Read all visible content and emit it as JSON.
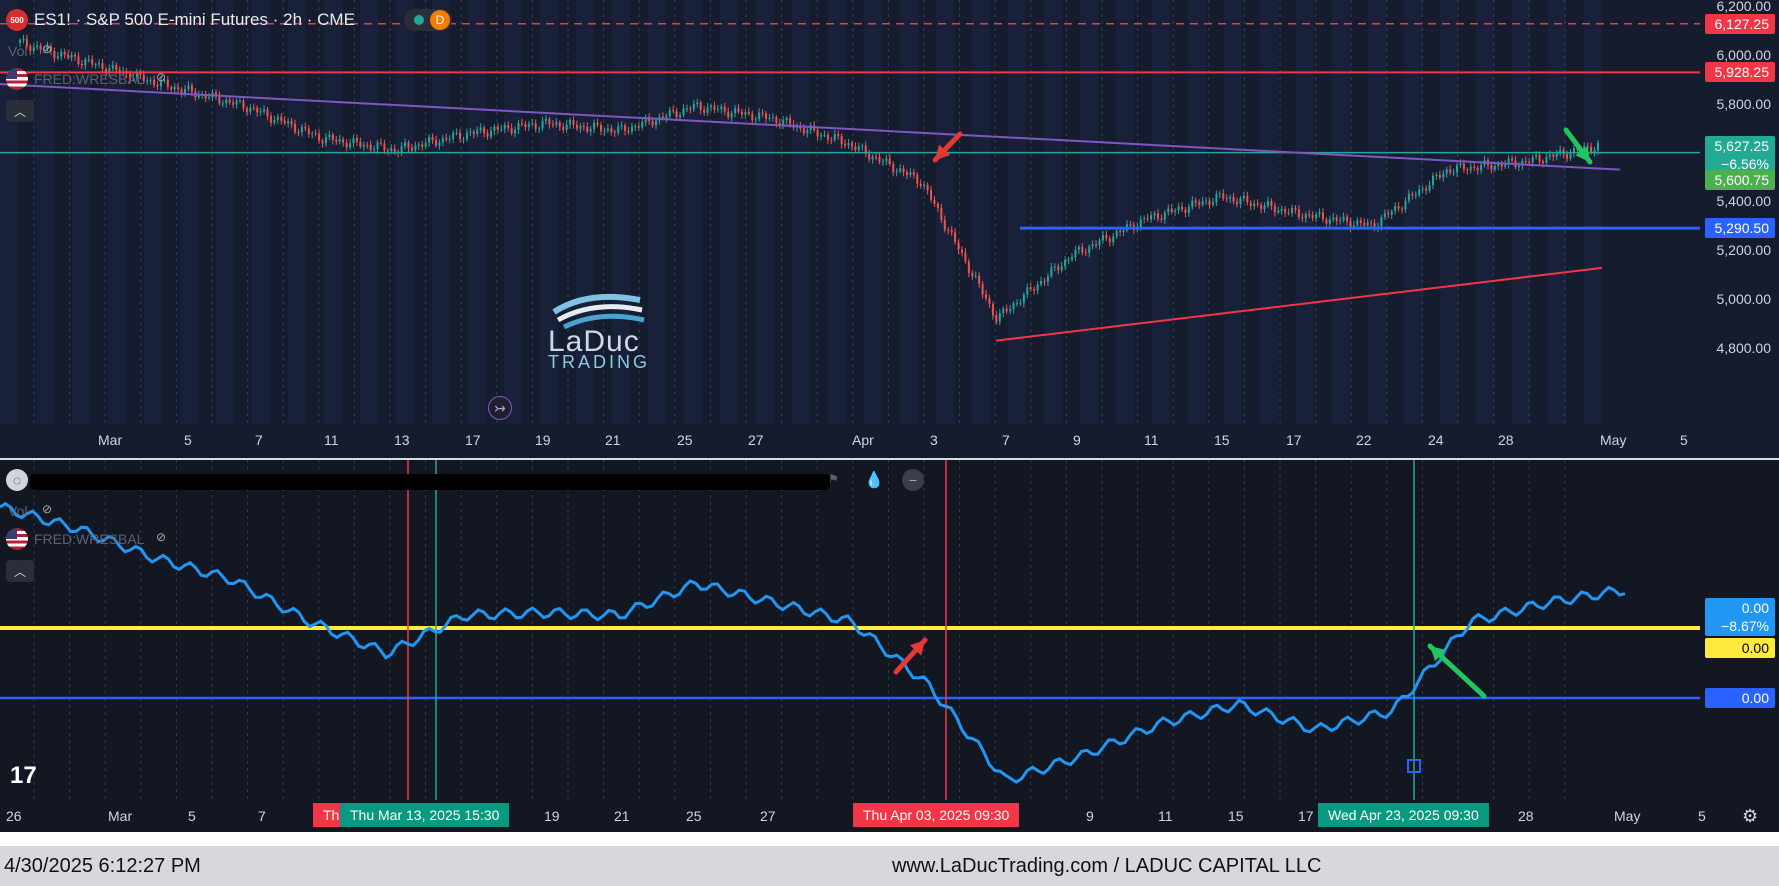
{
  "header": {
    "badge": "500",
    "symbol": "ES1!",
    "title": "S&P 500 E-mini Futures · 2h · CME",
    "status_letter": "D",
    "overlay_vol": "Vol",
    "overlay_fred": "FRED:WRESBAL"
  },
  "top_price_axis": [
    {
      "label": "6,200.00",
      "y": 6200
    },
    {
      "label": "6,000.00",
      "y": 6000
    },
    {
      "label": "5,800.00",
      "y": 5800
    },
    {
      "label": "5,400.00",
      "y": 5400
    },
    {
      "label": "5,200.00",
      "y": 5200
    },
    {
      "label": "5,000.00",
      "y": 5000
    },
    {
      "label": "4,800.00",
      "y": 4800
    }
  ],
  "top_tags": [
    {
      "label": "6,127.25",
      "color": "#f23645"
    },
    {
      "label": "5,928.25",
      "color": "#f23645"
    },
    {
      "label": "5,627.25",
      "color": "#22ab94"
    },
    {
      "label": "−6.56%",
      "color": "#22ab94"
    },
    {
      "label": "5,600.75",
      "color": "#4caf50"
    },
    {
      "label": "5,290.50",
      "color": "#2962ff"
    }
  ],
  "top_time_axis": [
    "Mar",
    "5",
    "7",
    "11",
    "13",
    "17",
    "19",
    "21",
    "25",
    "27",
    "Apr",
    "3",
    "7",
    "9",
    "11",
    "15",
    "17",
    "22",
    "24",
    "28",
    "May",
    "5"
  ],
  "bottom_tags": [
    {
      "label": "0.00",
      "color": "#2196f3"
    },
    {
      "label": "−8.67%",
      "color": "#2196f3"
    },
    {
      "label": "0.00",
      "color": "#ffeb3b"
    },
    {
      "label": "0.00",
      "color": "#2962ff"
    }
  ],
  "bottom_time_axis": [
    "26",
    "Mar",
    "5",
    "7",
    "19",
    "21",
    "25",
    "27",
    "9",
    "11",
    "15",
    "17",
    "28",
    "May",
    "5"
  ],
  "date_chips": [
    {
      "label": "Th",
      "color": "#f23645"
    },
    {
      "label": "Thu Mar 13, 2025   15:30",
      "color": "#089981"
    },
    {
      "label": "Thu Apr 03, 2025   09:30",
      "color": "#f23645"
    },
    {
      "label": "Wed Apr 23, 2025   09:30",
      "color": "#089981"
    }
  ],
  "logo": {
    "line1": "LaDuc",
    "line2": "TRADING"
  },
  "footer": {
    "timestamp": "4/30/2025 6:12:27 PM",
    "site": "www.LaDucTrading.com / LADUC CAPITAL LLC"
  },
  "colors": {
    "bull": "#26a69a",
    "bear": "#ef5350",
    "purple_trend": "#7e57c2",
    "red_level": "#f23645",
    "blue_level": "#2962ff",
    "yellow_level": "#ffeb3b",
    "indicator_line": "#2196f3"
  },
  "chart_data": [
    {
      "type": "candlestick",
      "title": "ES1! · S&P 500 E-mini Futures · 2h · CME",
      "ylim": [
        4750,
        6220
      ],
      "x": [
        "Feb 26",
        "Mar 3",
        "Mar 5",
        "Mar 7",
        "Mar 11",
        "Mar 13",
        "Mar 17",
        "Mar 19",
        "Mar 21",
        "Mar 25",
        "Mar 27",
        "Apr 1",
        "Apr 3",
        "Apr 7",
        "Apr 9",
        "Apr 11",
        "Apr 15",
        "Apr 17",
        "Apr 22",
        "Apr 24",
        "Apr 28",
        "Apr 30"
      ],
      "close": [
        6050,
        5960,
        5870,
        5790,
        5660,
        5610,
        5680,
        5720,
        5690,
        5790,
        5740,
        5640,
        5480,
        4920,
        5180,
        5330,
        5420,
        5350,
        5300,
        5530,
        5560,
        5627
      ],
      "levels": [
        6127.25,
        5928.25,
        5627.25,
        5600.75,
        5290.5
      ]
    },
    {
      "type": "line",
      "title": "FRED:WRESBAL",
      "x": [
        "Feb 26",
        "Mar 3",
        "Mar 5",
        "Mar 7",
        "Mar 11",
        "Mar 13",
        "Mar 17",
        "Mar 19",
        "Mar 21",
        "Mar 25",
        "Mar 27",
        "Apr 1",
        "Apr 3",
        "Apr 7",
        "Apr 9",
        "Apr 11",
        "Apr 15",
        "Apr 17",
        "Apr 22",
        "Apr 24",
        "Apr 28",
        "Apr 30"
      ],
      "values": [
        0.95,
        0.78,
        0.55,
        0.38,
        0.05,
        -0.2,
        0.1,
        0.12,
        0.1,
        0.35,
        0.2,
        0.05,
        -0.45,
        -1.2,
        -1.0,
        -0.75,
        -0.6,
        -0.8,
        -0.65,
        0.05,
        0.2,
        0.3
      ],
      "levels": [
        0.0,
        -0.55
      ]
    }
  ]
}
